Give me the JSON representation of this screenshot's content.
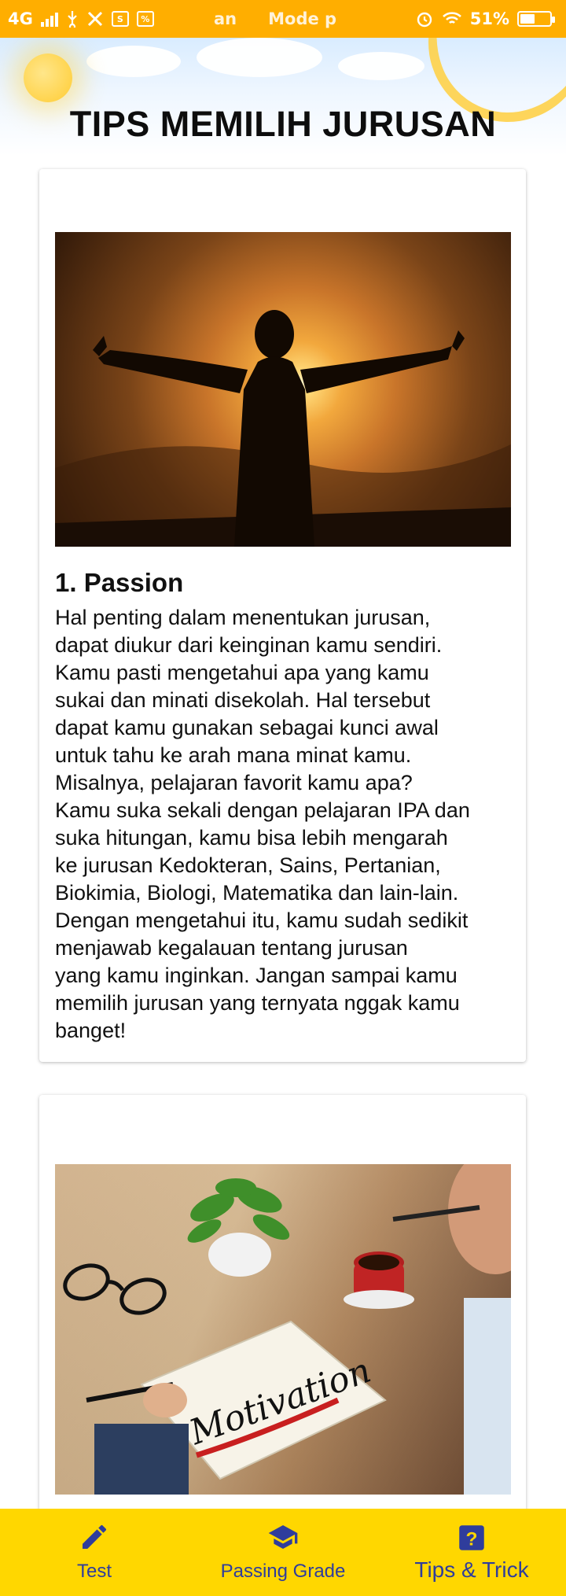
{
  "status_bar": {
    "network": "4G",
    "fragment_a": "an",
    "fragment_b": "Mode p",
    "battery": "51%",
    "battery_level": 0.51
  },
  "header": {
    "title": "TIPS MEMILIH JURUSAN"
  },
  "cards": [
    {
      "heading": "1. Passion",
      "body": "Hal penting dalam menentukan jurusan,\ndapat diukur dari keinginan kamu sendiri.\nKamu pasti mengetahui apa yang kamu\nsukai dan minati disekolah. Hal tersebut\ndapat kamu gunakan sebagai kunci awal\nuntuk tahu ke arah mana minat kamu.\nMisalnya, pelajaran favorit kamu apa?\nKamu suka sekali dengan pelajaran IPA dan\nsuka hitungan, kamu bisa lebih mengarah\nke jurusan Kedokteran, Sains, Pertanian,\nBiokimia, Biologi, Matematika dan lain-lain.\nDengan mengetahui itu, kamu sudah sedikit\nmenjawab kegalauan tentang jurusan\nyang kamu inginkan. Jangan sampai kamu\nmemilih jurusan yang ternyata nggak kamu\nbanget!"
    },
    {
      "image_text": "Motivation"
    }
  ],
  "bottom_nav": {
    "items": [
      {
        "label": "Test",
        "icon": "pencil-icon"
      },
      {
        "label": "Passing Grade",
        "icon": "graduation-cap-icon"
      },
      {
        "label": "Tips & Trick",
        "icon": "help-box-icon"
      }
    ],
    "active": "Tips & Trick"
  },
  "colors": {
    "status_bar": "#ffae00",
    "bottom_nav": "#ffd700",
    "nav_icon": "#2f3d9c"
  }
}
